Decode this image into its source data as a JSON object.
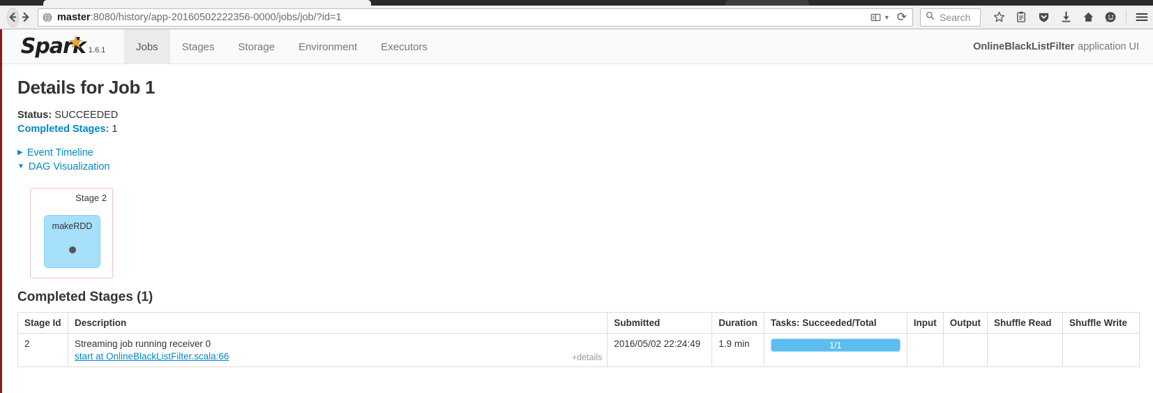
{
  "browser": {
    "url_host": "master",
    "url_rest": ":8080/history/app-20160502222356-0000/jobs/job/?id=1",
    "search_placeholder": "Search",
    "back_icon": "back-arrow-icon",
    "forward_icon": "forward-arrow-icon",
    "reload_icon": "reload-icon",
    "reader_icon": "reader-mode-icon",
    "toolbar_icons": [
      "bookmark-star-icon",
      "library-icon",
      "pocket-shield-icon",
      "downloads-icon",
      "home-icon",
      "feedback-smiley-icon",
      "hamburger-menu-icon"
    ]
  },
  "spark": {
    "logo_text": "Spark",
    "version": "1.6.1",
    "tabs": [
      {
        "label": "Jobs",
        "active": true
      },
      {
        "label": "Stages",
        "active": false
      },
      {
        "label": "Storage",
        "active": false
      },
      {
        "label": "Environment",
        "active": false
      },
      {
        "label": "Executors",
        "active": false
      }
    ],
    "app_name": "OnlineBlackListFilter",
    "app_suffix": "application UI"
  },
  "job": {
    "title": "Details for Job 1",
    "status_key": "Status:",
    "status_value": "SUCCEEDED",
    "completed_stages_key": "Completed Stages:",
    "completed_stages_value": "1",
    "event_timeline_label": "Event Timeline",
    "event_timeline_expanded": false,
    "dag_label": "DAG Visualization",
    "dag_expanded": true
  },
  "dag": {
    "stage_label": "Stage 2",
    "rdd_label": "makeRDD",
    "stage_border_color": "#f4bfc8",
    "rdd_fill_color": "#a6e0fa",
    "dot_color": "#555555"
  },
  "stages_section": {
    "heading": "Completed Stages (1)",
    "columns": [
      "Stage Id",
      "Description",
      "Submitted",
      "Duration",
      "Tasks: Succeeded/Total",
      "Input",
      "Output",
      "Shuffle Read",
      "Shuffle Write"
    ],
    "rows": [
      {
        "stage_id": "2",
        "description": "Streaming job running receiver 0",
        "description_link": "start at OnlineBlackListFilter.scala:66",
        "details_toggle": "+details",
        "submitted": "2016/05/02 22:24:49",
        "duration": "1.9 min",
        "tasks_text": "1/1",
        "tasks_percent": 100,
        "input": "",
        "output": "",
        "shuffle_read": "",
        "shuffle_write": ""
      }
    ]
  },
  "colors": {
    "link": "#0088cc",
    "accent_orange": "#e8a33d",
    "progress": "#5cbdee",
    "sidebar_red": "#8b1a1a"
  }
}
